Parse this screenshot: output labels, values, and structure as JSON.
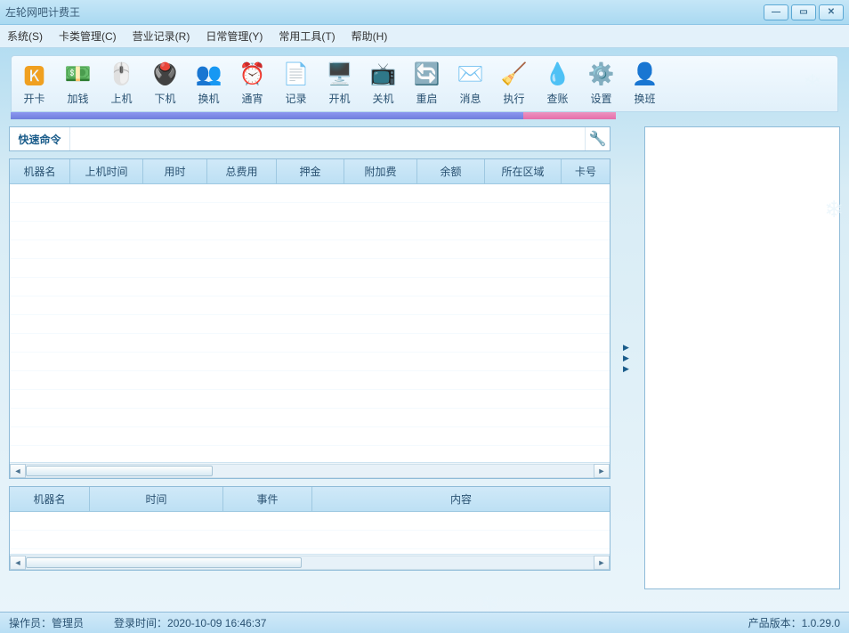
{
  "window": {
    "title": "左轮网吧计费王"
  },
  "menu": {
    "system": "系统(S)",
    "card": "卡类管理(C)",
    "biz": "营业记录(R)",
    "daily": "日常管理(Y)",
    "tools": "常用工具(T)",
    "help": "帮助(H)"
  },
  "toolbar": [
    {
      "id": "open-card",
      "label": "开卡",
      "glyph": "🅺",
      "color": "#f0a020"
    },
    {
      "id": "add-money",
      "label": "加钱",
      "glyph": "💵",
      "color": "#48b648"
    },
    {
      "id": "login",
      "label": "上机",
      "glyph": "🖱️",
      "color": "#e05a7a"
    },
    {
      "id": "logout",
      "label": "下机",
      "glyph": "🖲️",
      "color": "#e05a7a"
    },
    {
      "id": "swap",
      "label": "换机",
      "glyph": "👥",
      "color": "#f5a623"
    },
    {
      "id": "overnight",
      "label": "通宵",
      "glyph": "⏰",
      "color": "#3fa9d4"
    },
    {
      "id": "records",
      "label": "记录",
      "glyph": "📄",
      "color": "#5aa7e4"
    },
    {
      "id": "power-on",
      "label": "开机",
      "glyph": "🖥️",
      "color": "#5aa7e4"
    },
    {
      "id": "power-off",
      "label": "关机",
      "glyph": "📺",
      "color": "#cc3a3a"
    },
    {
      "id": "restart",
      "label": "重启",
      "glyph": "🔄",
      "color": "#4b8bd4"
    },
    {
      "id": "message",
      "label": "消息",
      "glyph": "✉️",
      "color": "#d8d8d8"
    },
    {
      "id": "execute",
      "label": "执行",
      "glyph": "🧹",
      "color": "#e29a3a"
    },
    {
      "id": "audit",
      "label": "查账",
      "glyph": "💧",
      "color": "#4fb0e6"
    },
    {
      "id": "settings",
      "label": "设置",
      "glyph": "⚙️",
      "color": "#f0a020"
    },
    {
      "id": "shift",
      "label": "换班",
      "glyph": "👤",
      "color": "#e05a7a"
    }
  ],
  "quick_cmd": {
    "label": "快速命令",
    "button_title": "搜索"
  },
  "grid1_headers": [
    "机器名",
    "上机时间",
    "用时",
    "总费用",
    "押金",
    "附加费",
    "余额",
    "所在区域",
    "卡号"
  ],
  "grid2_headers": [
    "机器名",
    "时间",
    "事件",
    "内容"
  ],
  "status": {
    "operator_label": "操作员：",
    "operator_value": "管理员",
    "login_time_label": "登录时间：",
    "login_time_value": "2020-10-09 16:46:37",
    "version_label": "产品版本：",
    "version_value": "1.0.29.0"
  }
}
